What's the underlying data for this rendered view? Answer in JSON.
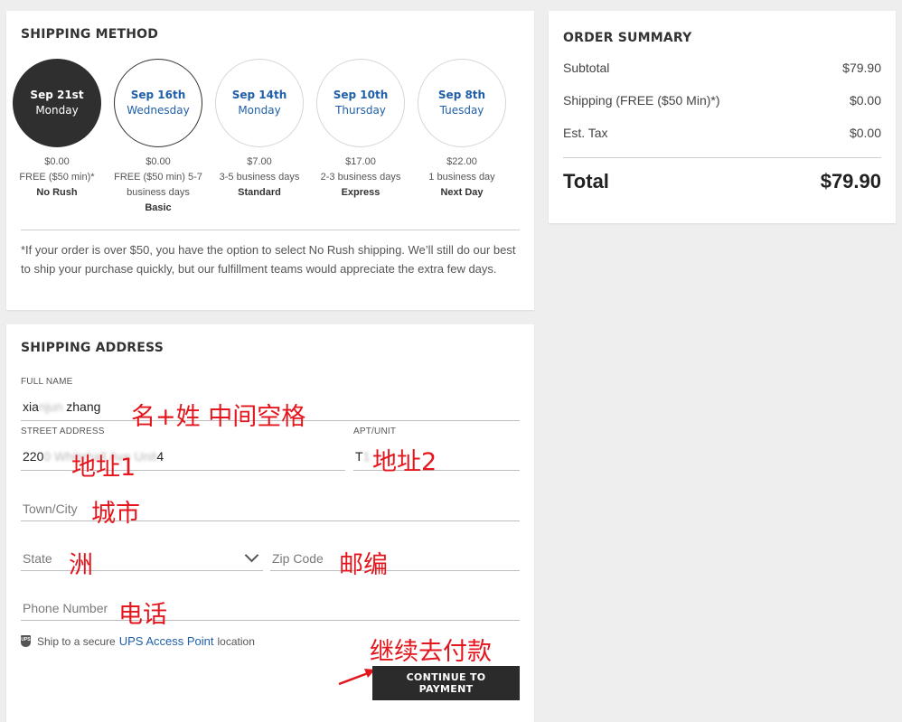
{
  "shipping_method": {
    "title": "SHIPPING METHOD",
    "options": [
      {
        "date": "Sep 21st",
        "weekday": "Monday",
        "price": "$0.00",
        "detail": "FREE ($50 min)*",
        "name": "No Rush",
        "selected": true
      },
      {
        "date": "Sep 16th",
        "weekday": "Wednesday",
        "price": "$0.00",
        "detail": "FREE ($50 min) 5-7 business days",
        "name": "Basic",
        "selected": false
      },
      {
        "date": "Sep 14th",
        "weekday": "Monday",
        "price": "$7.00",
        "detail": "3-5 business days",
        "name": "Standard",
        "selected": false
      },
      {
        "date": "Sep 10th",
        "weekday": "Thursday",
        "price": "$17.00",
        "detail": "2-3 business days",
        "name": "Express",
        "selected": false
      },
      {
        "date": "Sep 8th",
        "weekday": "Tuesday",
        "price": "$22.00",
        "detail": "1 business day",
        "name": "Next Day",
        "selected": false
      }
    ],
    "footnote": "*If your order is over $50, you have the option to select No Rush shipping. We’ll still do our best to ship your purchase quickly, but our fulfillment teams would appreciate the extra few days."
  },
  "order_summary": {
    "title": "ORDER SUMMARY",
    "subtotal_label": "Subtotal",
    "subtotal_value": "$79.90",
    "shipping_label": "Shipping (FREE ($50 Min)*)",
    "shipping_value": "$0.00",
    "tax_label": "Est. Tax",
    "tax_value": "$0.00",
    "total_label": "Total",
    "total_value": "$79.90"
  },
  "shipping_address": {
    "title": "SHIPPING ADDRESS",
    "full_name_label": "FULL NAME",
    "full_name_prefix": "xia",
    "full_name_blur": "njun",
    "full_name_suffix": " zhang",
    "street_label": "STREET ADDRESS",
    "street_prefix": "220",
    "street_blur": "0 Whitehall Ave Unit",
    "street_suffix": "4",
    "apt_label": "APT/UNIT",
    "apt_prefix": "T",
    "apt_blur": "1",
    "town_placeholder": "Town/City",
    "state_placeholder": "State",
    "zip_placeholder": "Zip Code",
    "phone_placeholder": "Phone Number",
    "ups_prefix": "Ship to a secure",
    "ups_link": "UPS Access Point",
    "ups_suffix": "location",
    "continue_button": "CONTINUE TO PAYMENT"
  },
  "annotations": {
    "name": "名+姓 中间空格",
    "address1": "地址1",
    "address2": "地址2",
    "city": "城市",
    "state": "洲",
    "zip": "邮编",
    "phone": "电话",
    "continue": "继续去付款"
  },
  "colors": {
    "accent_blue": "#1f5fa8",
    "annotation_red": "#e4161d",
    "dark_button": "#2b2b2b"
  }
}
